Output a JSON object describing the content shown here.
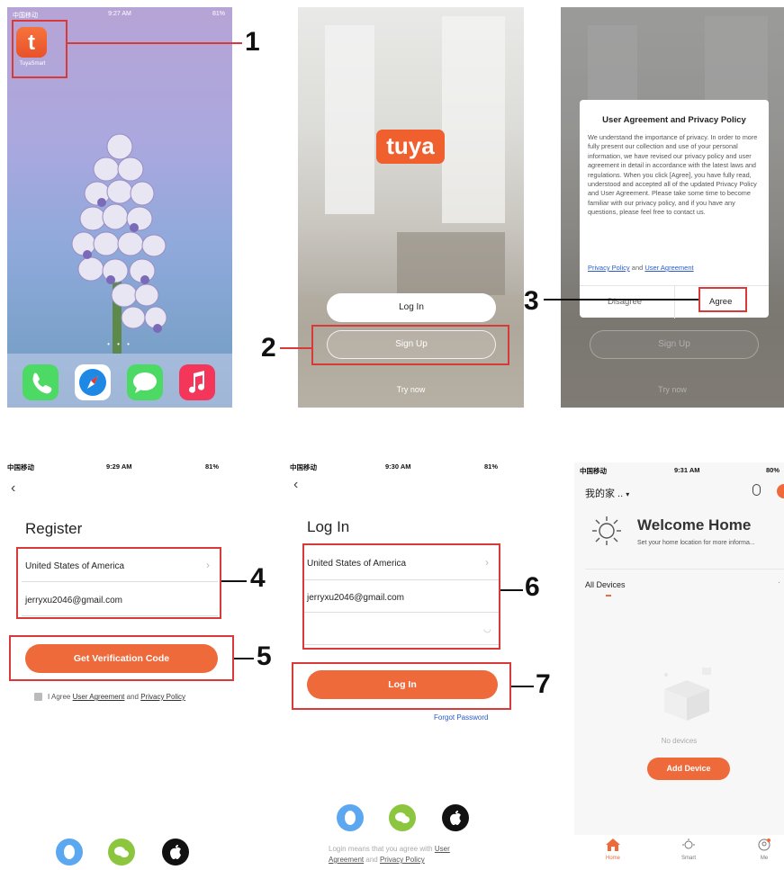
{
  "panel1": {
    "status": {
      "carrier": "中国移动",
      "time": "9:27 AM",
      "battery": "81%"
    },
    "app": {
      "icon_glyph": "t",
      "label": "TuyaSmart"
    },
    "dock_icons": [
      "phone-icon",
      "safari-icon",
      "messages-icon",
      "music-icon"
    ],
    "page_dots": "• • •"
  },
  "panel2": {
    "logo": "tuya",
    "login_label": "Log In",
    "signup_label": "Sign Up",
    "try_now": "Try now"
  },
  "panel3": {
    "dialog_title": "User Agreement and Privacy Policy",
    "dialog_body": "We understand the importance of privacy. In order to more fully present our collection and use of your personal information, we have revised our privacy policy and user agreement in detail in accordance with the latest laws and regulations. When you click [Agree], you have fully read, understood and accepted all of the updated Privacy Policy and User Agreement. Please take some time to become familiar with our privacy policy, and if you have any questions, please feel free to contact us.",
    "privacy_link": "Privacy Policy",
    "and_text": "and",
    "agreement_link": "User Agreement",
    "disagree": "Disagree",
    "agree": "Agree",
    "bg_signup": "Sign Up",
    "bg_try_now": "Try now"
  },
  "panel4": {
    "status": {
      "carrier": "中国移动",
      "time": "9:29 AM",
      "battery": "81%"
    },
    "title": "Register",
    "country": "United States of America",
    "email": "jerryxu2046@gmail.com",
    "button": "Get Verification Code",
    "agree_prefix": "I Agree",
    "user_agreement": "User Agreement",
    "and_text": "and",
    "privacy_policy": "Privacy Policy"
  },
  "panel5": {
    "status": {
      "carrier": "中国移动",
      "time": "9:30 AM",
      "battery": "81%"
    },
    "title": "Log In",
    "country": "United States of America",
    "email": "jerryxu2046@gmail.com",
    "button": "Log In",
    "forgot": "Forgot Password",
    "login_means": "Login means that you agree with",
    "user_link_a": "User",
    "user_link_b": "Agreement",
    "and_text": "and",
    "privacy_policy": "Privacy Policy"
  },
  "panel6": {
    "status": {
      "carrier": "中国移动",
      "time": "9:31 AM",
      "battery": "80%"
    },
    "home_name": "我的家 ..",
    "welcome": "Welcome Home",
    "subtitle": "Set your home location for more informa...",
    "all_devices": "All Devices",
    "no_devices": "No devices",
    "add_device": "Add Device",
    "tabs": [
      "Home",
      "Smart",
      "Me"
    ]
  },
  "callouts": [
    "1",
    "2",
    "3",
    "4",
    "5",
    "6",
    "7"
  ],
  "colors": {
    "accent": "#ee6a3b",
    "highlight": "#d83a3a",
    "link": "#2a5cc9"
  }
}
